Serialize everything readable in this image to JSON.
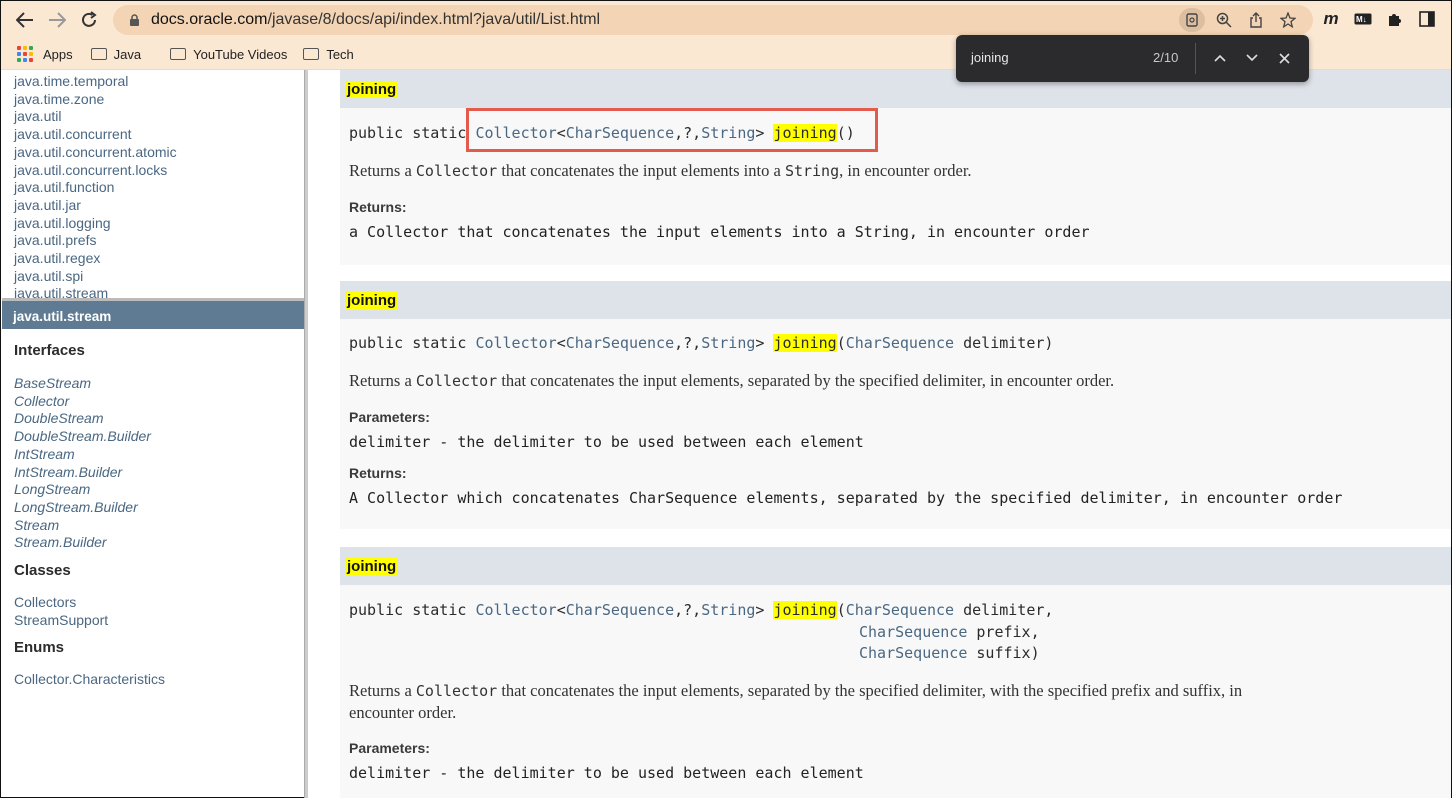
{
  "browser": {
    "url_host": "docs.oracle.com",
    "url_path": "/javase/8/docs/api/index.html?java/util/List.html",
    "bookmarks": [
      {
        "label": "Apps",
        "icon": "apps-grid-icon"
      },
      {
        "label": "Java",
        "icon": "folder-icon"
      },
      {
        "label": "YouTube Videos",
        "icon": "folder-icon"
      },
      {
        "label": "Tech",
        "icon": "folder-icon"
      }
    ],
    "extensions": {
      "m": "m",
      "md": "M↓"
    }
  },
  "find_bar": {
    "query": "joining",
    "count": "2/10"
  },
  "sidebar_top": {
    "packages": [
      "java.time.temporal",
      "java.time.zone",
      "java.util",
      "java.util.concurrent",
      "java.util.concurrent.atomic",
      "java.util.concurrent.locks",
      "java.util.function",
      "java.util.jar",
      "java.util.logging",
      "java.util.prefs",
      "java.util.regex",
      "java.util.spi",
      "java.util.stream"
    ]
  },
  "sidebar_bottom": {
    "package_title": "java.util.stream",
    "interfaces_title": "Interfaces",
    "interfaces": [
      "BaseStream",
      "Collector",
      "DoubleStream",
      "DoubleStream.Builder",
      "IntStream",
      "IntStream.Builder",
      "LongStream",
      "LongStream.Builder",
      "Stream",
      "Stream.Builder"
    ],
    "classes_title": "Classes",
    "classes": [
      "Collectors",
      "StreamSupport"
    ],
    "enums_title": "Enums",
    "enums": [
      "Collector.Characteristics"
    ]
  },
  "main": {
    "blocks": [
      {
        "name": "joining",
        "sig_prefix": "public static ",
        "sig_type": "Collector",
        "sig_lt": "<",
        "sig_t1": "CharSequence",
        "sig_mid": ",?,",
        "sig_t2": "String",
        "sig_gt": "> ",
        "sig_method": "joining",
        "sig_params": "()",
        "desc_pre": "Returns a ",
        "desc_code": "Collector",
        "desc_mid": " that concatenates the input elements into a ",
        "desc_code2": "String",
        "desc_post": ", in encounter order.",
        "returns_label": "Returns:",
        "returns_text": "a Collector that concatenates the input elements into a String, in encounter order"
      },
      {
        "name": "joining",
        "sig_prefix": "public static ",
        "sig_type": "Collector",
        "sig_lt": "<",
        "sig_t1": "CharSequence",
        "sig_mid": ",?,",
        "sig_t2": "String",
        "sig_gt": "> ",
        "sig_method": "joining",
        "sig_open": "(",
        "sig_ptype": "CharSequence",
        "sig_pname": " delimiter)",
        "desc_pre": "Returns a ",
        "desc_code": "Collector",
        "desc_post": " that concatenates the input elements, separated by the specified delimiter, in encounter order.",
        "params_label": "Parameters:",
        "params_text": "delimiter - the delimiter to be used between each element",
        "returns_label": "Returns:",
        "returns_text": "A Collector which concatenates CharSequence elements, separated by the specified delimiter, in encounter order"
      },
      {
        "name": "joining",
        "sig_prefix": "public static ",
        "sig_type": "Collector",
        "sig_lt": "<",
        "sig_t1": "CharSequence",
        "sig_mid": ",?,",
        "sig_t2": "String",
        "sig_gt": "> ",
        "sig_method": "joining",
        "sig_open": "(",
        "sig_ptype": "CharSequence",
        "sig_p1": " delimiter,",
        "sig_p2": " prefix,",
        "sig_p3": " suffix)",
        "desc_pre": "Returns a ",
        "desc_code": "Collector",
        "desc_post": " that concatenates the input elements, separated by the specified delimiter, with the specified prefix and suffix, in",
        "desc_line2": "encounter order.",
        "params_label": "Parameters:",
        "params_text": "delimiter - the delimiter to be used between each element"
      }
    ]
  }
}
